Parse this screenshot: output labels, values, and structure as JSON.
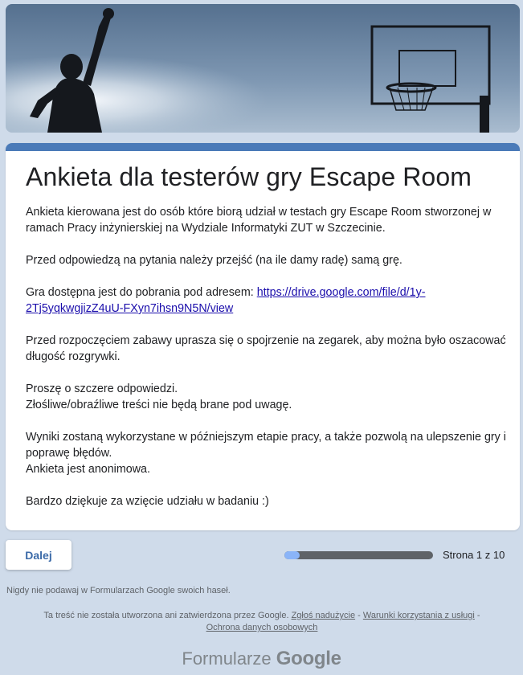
{
  "header": {
    "banner_image": "basketball-player-silhouette-and-hoop"
  },
  "form": {
    "title": "Ankieta dla testerów gry Escape Room",
    "paragraphs": {
      "p1": "Ankieta kierowana jest do osób które biorą udział w testach gry Escape Room stworzonej w ramach Pracy inżynierskiej na Wydziale Informatyki ZUT w Szczecinie.",
      "p2": "Przed odpowiedzą na pytania należy przejść (na ile damy radę) samą grę.",
      "p3_prefix": "Gra dostępna jest do pobrania pod adresem: ",
      "p3_link": "https://drive.google.com/file/d/1y-2Tj5yqkwgjizZ4uU-FXyn7ihsn9N5N/view",
      "p4": "Przed rozpoczęciem zabawy uprasza się o spojrzenie na zegarek, aby można  było oszacować długość rozgrywki.",
      "p5_line1": "Proszę o szczere odpowiedzi.",
      "p5_line2": "Złośliwe/obraźliwe treści nie będą brane pod uwagę.",
      "p6_line1": "Wyniki zostaną wykorzystane w późniejszym etapie pracy, a także pozwolą na ulepszenie gry i poprawę błędów.",
      "p6_line2": "Ankieta jest anonimowa.",
      "p7": "Bardzo dziękuje za wzięcie udziału w badaniu :)"
    }
  },
  "navigation": {
    "next_label": "Dalej",
    "page_label": "Strona 1 z 10",
    "progress_fraction": 0.1
  },
  "footer": {
    "password_warning": "Nigdy nie podawaj w Formularzach Google swoich haseł.",
    "disclaimer_text": "Ta treść nie została utworzona ani zatwierdzona przez Google. ",
    "report_abuse": "Zgłoś nadużycie",
    "separator": " - ",
    "terms": "Warunki korzystania z usługi",
    "privacy": "Ochrona danych osobowych",
    "brand_prefix": "Formularze",
    "brand_google": "Google"
  },
  "colors": {
    "accent": "#4a7ab8",
    "background": "#cfdbea",
    "link": "#1a0dab"
  }
}
